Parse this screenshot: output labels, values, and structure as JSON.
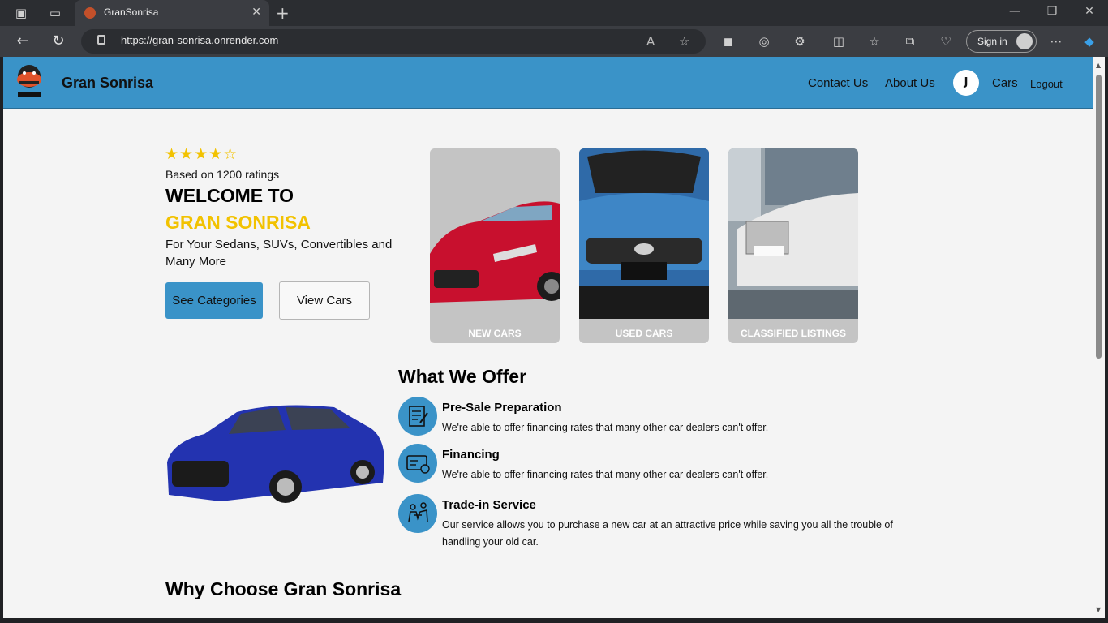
{
  "browser": {
    "tab_title": "GranSonrisa",
    "url": "https://gran-sonrisa.onrender.com",
    "sign_in": "Sign in"
  },
  "header": {
    "brand": "Gran Sonrisa",
    "nav": {
      "contact": "Contact Us",
      "about": "About Us",
      "user_initial": "J",
      "cars": "Cars",
      "logout": "Logout"
    },
    "color": "#3a93c8"
  },
  "hero": {
    "stars": "★★★★☆",
    "rating_value": 4,
    "ratings_text": "Based on 1200 ratings",
    "welcome": "WELCOME TO",
    "brand_upper": "GRAN SONRISA",
    "brand_color": "#f2c200",
    "tagline": "For Your Sedans, SUVs, Convertibles and Many More",
    "btn_categories": "See Categories",
    "btn_view_cars": "View Cars"
  },
  "categories": [
    {
      "label": "NEW CARS"
    },
    {
      "label": "USED CARS"
    },
    {
      "label": "CLASSIFIED LISTINGS"
    }
  ],
  "offer": {
    "title": "What We Offer",
    "items": [
      {
        "title": "Pre-Sale Preparation",
        "text": "We're able to offer financing rates that many other car dealers can't offer.",
        "icon": "document-edit-icon"
      },
      {
        "title": "Financing",
        "text": "We're able to offer financing rates that many other car dealers can't offer.",
        "icon": "credit-card-icon"
      },
      {
        "title": "Trade-in Service",
        "text": "Our service allows you to purchase a new car at an attractive price while saving you all the trouble of handling your old car.",
        "icon": "handshake-icon"
      }
    ]
  },
  "why": {
    "title": "Why Choose Gran Sonrisa"
  }
}
